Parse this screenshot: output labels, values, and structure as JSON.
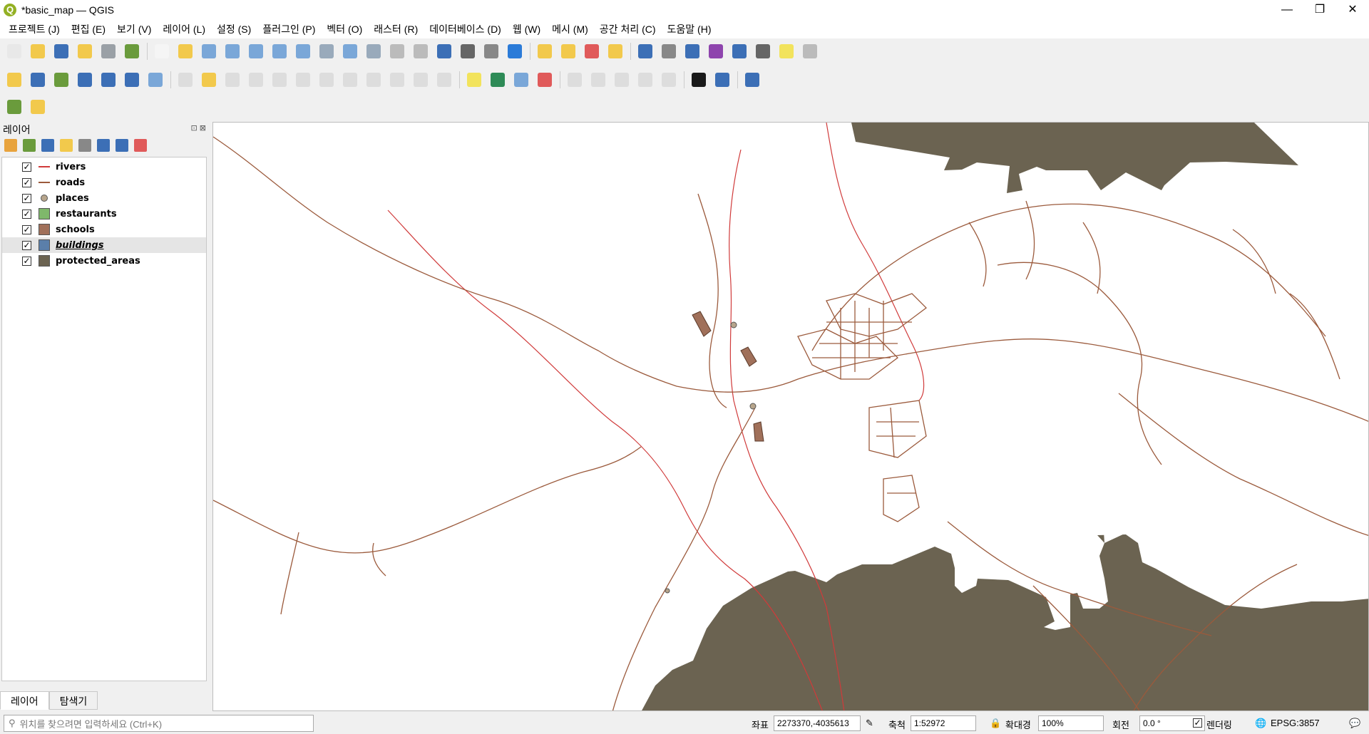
{
  "window": {
    "title": "*basic_map — QGIS",
    "app_icon_letter": "Q",
    "controls": {
      "minimize": "—",
      "restore": "❐",
      "close": "✕"
    }
  },
  "menu": [
    "프로젝트 (J)",
    "편집 (E)",
    "보기 (V)",
    "레이어 (L)",
    "설정 (S)",
    "플러그인 (P)",
    "벡터 (O)",
    "래스터 (R)",
    "데이터베이스 (D)",
    "웹 (W)",
    "메시 (M)",
    "공간 처리 (C)",
    "도움말 (H)"
  ],
  "toolbars": {
    "row1": [
      {
        "icon": "new-project-icon",
        "color": "#e8e8e8"
      },
      {
        "icon": "open-project-icon",
        "color": "#f2c94c"
      },
      {
        "icon": "save-project-icon",
        "color": "#3c6fb6"
      },
      {
        "icon": "save-as-icon",
        "color": "#f2c94c"
      },
      {
        "icon": "print-layout-icon",
        "color": "#9aa0a6"
      },
      {
        "icon": "style-manager-icon",
        "color": "#6a9b3c"
      },
      {
        "sep": true
      },
      {
        "icon": "pan-icon",
        "color": "#f5f5f5"
      },
      {
        "icon": "pan-to-selection-icon",
        "color": "#f2c94c"
      },
      {
        "icon": "zoom-in-icon",
        "color": "#7aa7d8"
      },
      {
        "icon": "zoom-out-icon",
        "color": "#7aa7d8"
      },
      {
        "icon": "zoom-full-icon",
        "color": "#7aa7d8"
      },
      {
        "icon": "zoom-selection-icon",
        "color": "#7aa7d8"
      },
      {
        "icon": "zoom-layer-icon",
        "color": "#7aa7d8"
      },
      {
        "icon": "zoom-native-icon",
        "color": "#9ab"
      },
      {
        "icon": "zoom-last-icon",
        "color": "#7aa7d8"
      },
      {
        "icon": "zoom-next-icon",
        "color": "#9ab"
      },
      {
        "icon": "new-map-view-icon",
        "color": "#bbb"
      },
      {
        "icon": "new-3d-view-icon",
        "color": "#bbb"
      },
      {
        "icon": "new-bookmark-icon",
        "color": "#3c6fb6"
      },
      {
        "icon": "show-bookmarks-icon",
        "color": "#666"
      },
      {
        "icon": "temporal-icon",
        "color": "#888"
      },
      {
        "icon": "refresh-icon",
        "color": "#2b7bd8"
      },
      {
        "sep": true
      },
      {
        "icon": "select-features-icon",
        "color": "#f2c94c"
      },
      {
        "icon": "select-by-value-icon",
        "color": "#f2c94c"
      },
      {
        "icon": "deselect-icon",
        "color": "#e05a5a"
      },
      {
        "icon": "select-location-icon",
        "color": "#f2c94c"
      },
      {
        "sep": true
      },
      {
        "icon": "identify-icon",
        "color": "#3c6fb6"
      },
      {
        "icon": "attribute-table-icon",
        "color": "#888"
      },
      {
        "icon": "toolbox-icon",
        "color": "#3c6fb6"
      },
      {
        "icon": "statistics-icon",
        "color": "#8e44ad"
      },
      {
        "icon": "open-field-calc-icon",
        "color": "#3c6fb6"
      },
      {
        "icon": "measure-icon",
        "color": "#666"
      },
      {
        "icon": "map-tips-icon",
        "color": "#f2e35c"
      },
      {
        "icon": "locator-icon",
        "color": "#bbb"
      }
    ],
    "row2": [
      {
        "icon": "add-vector-icon",
        "color": "#f2c94c"
      },
      {
        "icon": "add-raster-icon",
        "color": "#3c6fb6"
      },
      {
        "icon": "add-delimited-icon",
        "color": "#6a9b3c"
      },
      {
        "icon": "add-spatialite-icon",
        "color": "#3c6fb6"
      },
      {
        "icon": "add-wms-icon",
        "color": "#3c6fb6"
      },
      {
        "icon": "add-mesh-icon",
        "color": "#3c6fb6"
      },
      {
        "icon": "add-virtual-icon",
        "color": "#7aa7d8"
      },
      {
        "sep": true
      },
      {
        "icon": "edit-icon",
        "color": "#bbb",
        "dim": true
      },
      {
        "icon": "toggle-editing-icon",
        "color": "#f2c94c"
      },
      {
        "icon": "save-edits-icon",
        "color": "#bbb",
        "dim": true
      },
      {
        "icon": "add-feature-icon",
        "color": "#bbb",
        "dim": true
      },
      {
        "icon": "vertex-tool-icon",
        "color": "#bbb",
        "dim": true
      },
      {
        "icon": "modify-attributes-icon",
        "color": "#bbb",
        "dim": true
      },
      {
        "icon": "delete-selected-icon",
        "color": "#bbb",
        "dim": true
      },
      {
        "icon": "cut-icon",
        "color": "#bbb",
        "dim": true
      },
      {
        "icon": "copy-icon",
        "color": "#bbb",
        "dim": true
      },
      {
        "icon": "paste-icon",
        "color": "#bbb",
        "dim": true
      },
      {
        "icon": "undo-icon",
        "color": "#bbb",
        "dim": true
      },
      {
        "icon": "redo-icon",
        "color": "#bbb",
        "dim": true
      },
      {
        "sep": true
      },
      {
        "icon": "labeling-icon",
        "color": "#f2e35c"
      },
      {
        "icon": "diagram-icon",
        "color": "#2e8b57"
      },
      {
        "icon": "label-pin-icon",
        "color": "#7aa7d8"
      },
      {
        "icon": "label-unpinned-icon",
        "color": "#e05a5a"
      },
      {
        "sep": true
      },
      {
        "icon": "highlight-pinned-icon",
        "color": "#bbb",
        "dim": true
      },
      {
        "icon": "show-hide-labels-icon",
        "color": "#bbb",
        "dim": true
      },
      {
        "icon": "move-label-icon",
        "color": "#bbb",
        "dim": true
      },
      {
        "icon": "rotate-label-icon",
        "color": "#bbb",
        "dim": true
      },
      {
        "icon": "change-label-icon",
        "color": "#bbb",
        "dim": true
      },
      {
        "sep": true
      },
      {
        "icon": "metasearch-icon",
        "color": "#1a1a1a"
      },
      {
        "icon": "python-icon",
        "color": "#3c6fb6"
      },
      {
        "sep": true
      },
      {
        "icon": "help-icon",
        "color": "#3c6fb6"
      }
    ],
    "row3": [
      {
        "icon": "locator-search-icon",
        "color": "#6a9b3c"
      },
      {
        "icon": "georeferencer-icon",
        "color": "#f2c94c"
      }
    ]
  },
  "layers_panel": {
    "title": "레이어",
    "controls": "⊡ ⊠",
    "tool_icons": [
      {
        "icon": "open-layer-styling-icon",
        "color": "#e8a33d"
      },
      {
        "icon": "add-group-icon",
        "color": "#6a9b3c"
      },
      {
        "icon": "manage-visibility-icon",
        "color": "#3c6fb6"
      },
      {
        "icon": "filter-legend-icon",
        "color": "#f2c94c"
      },
      {
        "icon": "filter-expression-icon",
        "color": "#888"
      },
      {
        "icon": "expand-all-icon",
        "color": "#3c6fb6"
      },
      {
        "icon": "collapse-all-icon",
        "color": "#3c6fb6"
      },
      {
        "icon": "remove-layer-icon",
        "color": "#e05a5a"
      }
    ],
    "layers": [
      {
        "name": "rivers",
        "checked": "✓",
        "symbol": "line",
        "color": "#d03a3a",
        "selected": false,
        "italic": false
      },
      {
        "name": "roads",
        "checked": "✓",
        "symbol": "line",
        "color": "#9b5a3c",
        "selected": false,
        "italic": false
      },
      {
        "name": "places",
        "checked": "✓",
        "symbol": "point",
        "color": "#b7a58c",
        "selected": false,
        "italic": false
      },
      {
        "name": "restaurants",
        "checked": "✓",
        "symbol": "fill",
        "color": "#7fb86b",
        "selected": false,
        "italic": false
      },
      {
        "name": "schools",
        "checked": "✓",
        "symbol": "fill",
        "color": "#a0705a",
        "selected": false,
        "italic": false
      },
      {
        "name": "buildings",
        "checked": "✓",
        "symbol": "fill",
        "color": "#5b7faa",
        "selected": true,
        "italic": true
      },
      {
        "name": "protected_areas",
        "checked": "✓",
        "symbol": "fill",
        "color": "#6b6351",
        "selected": false,
        "italic": false
      }
    ],
    "tabs": [
      "레이어",
      "탐색기"
    ]
  },
  "statusbar": {
    "locator_placeholder": "위치를 찾으려면 입력하세요 (Ctrl+K)",
    "coordinate_label": "좌표",
    "coordinate_value": "2273370,-4035613",
    "scale_label": "축척",
    "scale_value": "1:52972",
    "magnifier_label": "확대경",
    "magnifier_value": "100%",
    "rotation_label": "회전",
    "rotation_value": "0.0 °",
    "render_label": "렌더링",
    "render_checked": "✓",
    "crs": "EPSG:3857"
  },
  "map_colors": {
    "road": "#9b5a3c",
    "river": "#d03a3a",
    "protected": "#6b6351",
    "school": "#a0705a",
    "place": "#b7a58c"
  }
}
